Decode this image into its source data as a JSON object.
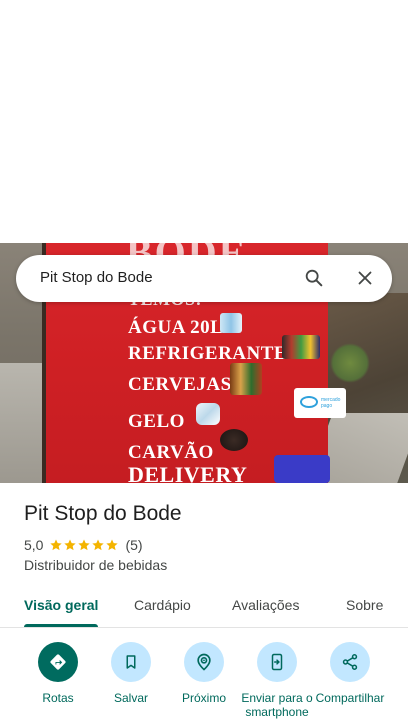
{
  "search": {
    "query": "Pit Stop do Bode"
  },
  "photo": {
    "board_top": "BODE",
    "lines": [
      "TEMOS:",
      "ÁGUA 20L",
      "REFRIGERANTES",
      "CERVEJAS",
      "GELO",
      "CARVÃO",
      "DELIVERY"
    ],
    "sticker_text": "mercado pago"
  },
  "place": {
    "name": "Pit Stop do Bode",
    "rating": "5,0",
    "stars": 5,
    "review_count": "(5)",
    "category": "Distribuidor de bebidas"
  },
  "tabs": [
    {
      "label": "Visão geral",
      "active": true
    },
    {
      "label": "Cardápio",
      "active": false
    },
    {
      "label": "Avaliações",
      "active": false
    },
    {
      "label": "Sobre",
      "active": false
    }
  ],
  "actions": [
    {
      "label": "Rotas",
      "icon": "directions-icon"
    },
    {
      "label": "Salvar",
      "icon": "bookmark-icon"
    },
    {
      "label": "Próximo",
      "icon": "nearby-icon"
    },
    {
      "label": "Enviar para o smartphone",
      "icon": "send-to-phone-icon"
    },
    {
      "label": "Compartilhar",
      "icon": "share-icon"
    }
  ],
  "colors": {
    "accent": "#00695c",
    "primary_button": "#006b5f",
    "secondary_button": "#c2e7ff",
    "star": "#f4b400"
  }
}
